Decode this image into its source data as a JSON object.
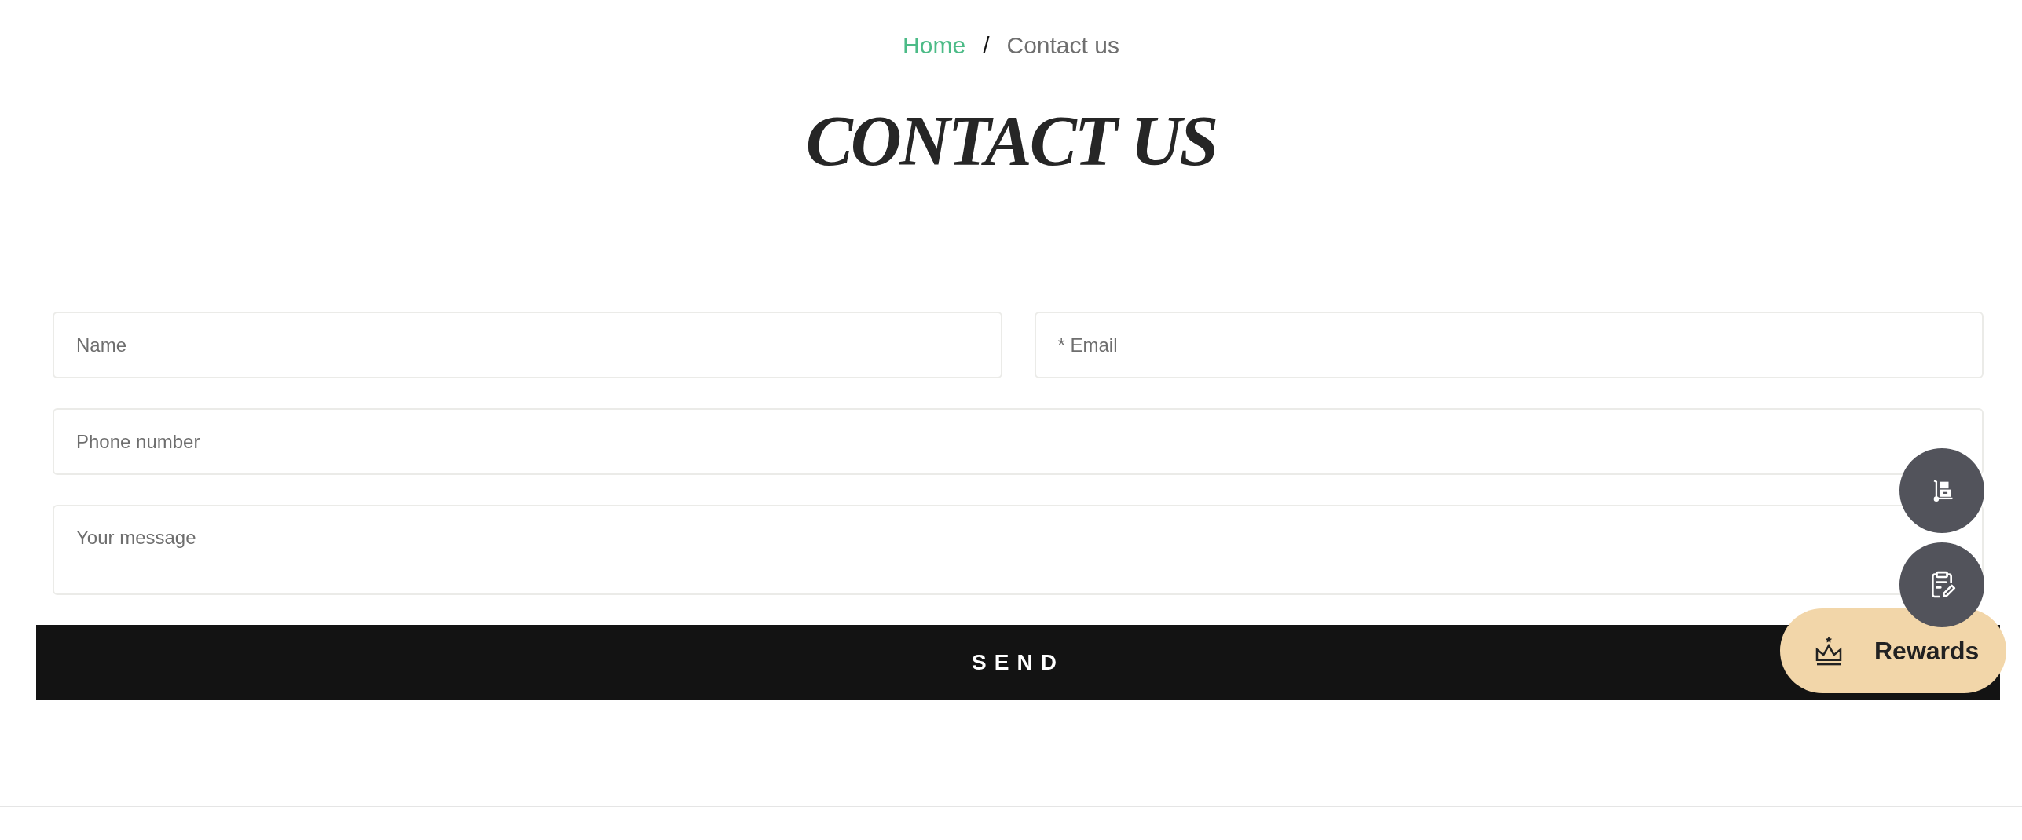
{
  "breadcrumb": [
    {
      "label": "Home",
      "kind": "link"
    },
    {
      "label": "/",
      "kind": "separator"
    },
    {
      "label": "Contact us",
      "kind": "current"
    }
  ],
  "title": "CONTACT US",
  "form": {
    "rows": [
      [
        {
          "kind": "input",
          "placeholder": "Name"
        },
        {
          "kind": "input",
          "placeholder": "* Email"
        }
      ],
      [
        {
          "kind": "input",
          "placeholder": "Phone number"
        }
      ],
      [
        {
          "kind": "textarea",
          "placeholder": "Your message"
        }
      ]
    ],
    "submit": "SEND"
  },
  "floating_buttons": [
    {
      "kind": "cart"
    },
    {
      "kind": "clipboard"
    }
  ],
  "rewards": {
    "label": "Rewards"
  }
}
